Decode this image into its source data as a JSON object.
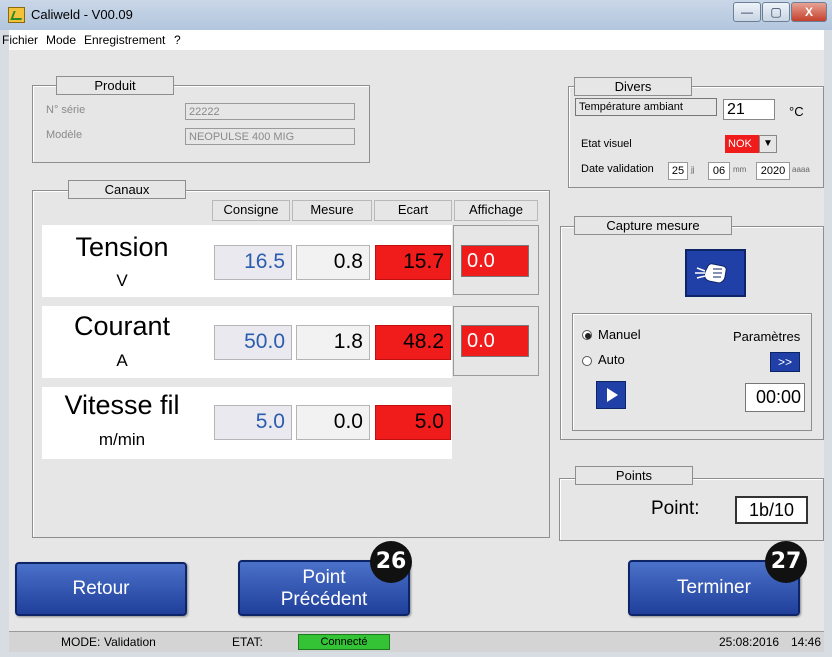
{
  "window": {
    "title": "Caliweld - V00.09",
    "buttons": {
      "minimize": "—",
      "maximize": "▢",
      "close": "X"
    }
  },
  "menu": [
    "Fichier",
    "Mode",
    "Enregistrement",
    "?"
  ],
  "produit": {
    "legend": "Produit",
    "serie_label": "N° série",
    "serie_value": "22222",
    "modele_label": "Modèle",
    "modele_value": "NEOPULSE 400 MIG"
  },
  "divers": {
    "legend": "Divers",
    "temp_label": "Température ambiant",
    "temp_value": "21",
    "temp_unit": "°C",
    "etat_label": "Etat visuel",
    "etat_value": "NOK",
    "date_label": "Date validation",
    "date_day": "25",
    "date_day_unit": "jj",
    "date_month": "06",
    "date_month_unit": "mm",
    "date_year": "2020",
    "date_year_unit": "aaaa"
  },
  "canaux": {
    "legend": "Canaux",
    "headers": {
      "consigne": "Consigne",
      "mesure": "Mesure",
      "ecart": "Ecart",
      "affichage": "Affichage"
    },
    "rows": [
      {
        "name": "Tension",
        "unit": "V",
        "consigne": "16.5",
        "mesure": "0.8",
        "ecart": "15.7",
        "affichage": "0.0"
      },
      {
        "name": "Courant",
        "unit": "A",
        "consigne": "50.0",
        "mesure": "1.8",
        "ecart": "48.2",
        "affichage": "0.0"
      },
      {
        "name": "Vitesse fil",
        "unit": "m/min",
        "consigne": "5.0",
        "mesure": "0.0",
        "ecart": "5.0"
      }
    ]
  },
  "capture": {
    "legend": "Capture mesure",
    "manuel": "Manuel",
    "auto": "Auto",
    "parametres": "Paramètres",
    "params_btn": ">>",
    "timer": "00:00"
  },
  "points": {
    "legend": "Points",
    "label": "Point:",
    "value": "1b/10"
  },
  "buttons": {
    "retour": "Retour",
    "precedent_line1": "Point",
    "precedent_line2": "Précédent",
    "terminer": "Terminer"
  },
  "badges": {
    "b26": "26",
    "b27": "27"
  },
  "status": {
    "mode_label": "MODE:",
    "mode_value": "Validation",
    "etat_label": "ETAT:",
    "etat_value": "Connecté",
    "date": "25:08:2016",
    "time": "14:46"
  },
  "colors": {
    "ecart_red": "#f01b1b",
    "button_blue": "#2a4fb0",
    "connected_green": "#34c334"
  }
}
